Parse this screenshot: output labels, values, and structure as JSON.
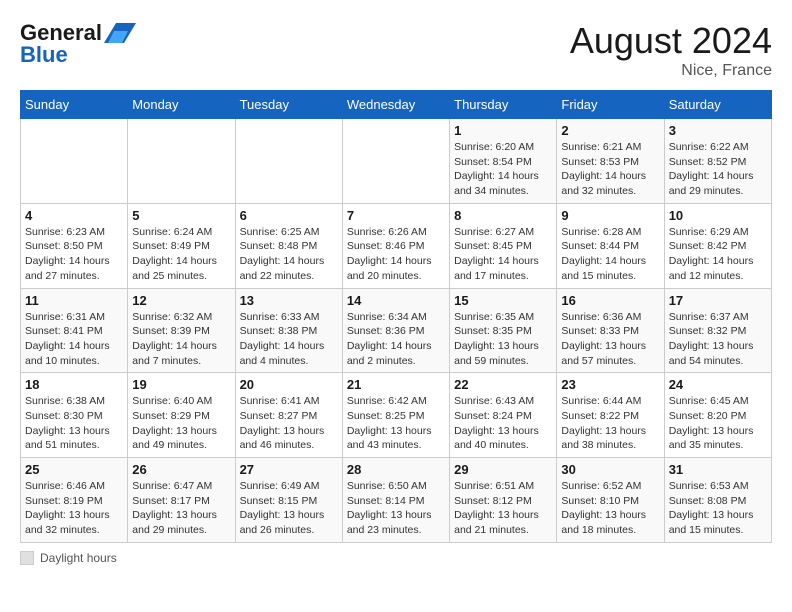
{
  "header": {
    "logo_general": "General",
    "logo_blue": "Blue",
    "month": "August 2024",
    "location": "Nice, France"
  },
  "days_of_week": [
    "Sunday",
    "Monday",
    "Tuesday",
    "Wednesday",
    "Thursday",
    "Friday",
    "Saturday"
  ],
  "weeks": [
    [
      {
        "day": "",
        "info": ""
      },
      {
        "day": "",
        "info": ""
      },
      {
        "day": "",
        "info": ""
      },
      {
        "day": "",
        "info": ""
      },
      {
        "day": "1",
        "info": "Sunrise: 6:20 AM\nSunset: 8:54 PM\nDaylight: 14 hours and 34 minutes."
      },
      {
        "day": "2",
        "info": "Sunrise: 6:21 AM\nSunset: 8:53 PM\nDaylight: 14 hours and 32 minutes."
      },
      {
        "day": "3",
        "info": "Sunrise: 6:22 AM\nSunset: 8:52 PM\nDaylight: 14 hours and 29 minutes."
      }
    ],
    [
      {
        "day": "4",
        "info": "Sunrise: 6:23 AM\nSunset: 8:50 PM\nDaylight: 14 hours and 27 minutes."
      },
      {
        "day": "5",
        "info": "Sunrise: 6:24 AM\nSunset: 8:49 PM\nDaylight: 14 hours and 25 minutes."
      },
      {
        "day": "6",
        "info": "Sunrise: 6:25 AM\nSunset: 8:48 PM\nDaylight: 14 hours and 22 minutes."
      },
      {
        "day": "7",
        "info": "Sunrise: 6:26 AM\nSunset: 8:46 PM\nDaylight: 14 hours and 20 minutes."
      },
      {
        "day": "8",
        "info": "Sunrise: 6:27 AM\nSunset: 8:45 PM\nDaylight: 14 hours and 17 minutes."
      },
      {
        "day": "9",
        "info": "Sunrise: 6:28 AM\nSunset: 8:44 PM\nDaylight: 14 hours and 15 minutes."
      },
      {
        "day": "10",
        "info": "Sunrise: 6:29 AM\nSunset: 8:42 PM\nDaylight: 14 hours and 12 minutes."
      }
    ],
    [
      {
        "day": "11",
        "info": "Sunrise: 6:31 AM\nSunset: 8:41 PM\nDaylight: 14 hours and 10 minutes."
      },
      {
        "day": "12",
        "info": "Sunrise: 6:32 AM\nSunset: 8:39 PM\nDaylight: 14 hours and 7 minutes."
      },
      {
        "day": "13",
        "info": "Sunrise: 6:33 AM\nSunset: 8:38 PM\nDaylight: 14 hours and 4 minutes."
      },
      {
        "day": "14",
        "info": "Sunrise: 6:34 AM\nSunset: 8:36 PM\nDaylight: 14 hours and 2 minutes."
      },
      {
        "day": "15",
        "info": "Sunrise: 6:35 AM\nSunset: 8:35 PM\nDaylight: 13 hours and 59 minutes."
      },
      {
        "day": "16",
        "info": "Sunrise: 6:36 AM\nSunset: 8:33 PM\nDaylight: 13 hours and 57 minutes."
      },
      {
        "day": "17",
        "info": "Sunrise: 6:37 AM\nSunset: 8:32 PM\nDaylight: 13 hours and 54 minutes."
      }
    ],
    [
      {
        "day": "18",
        "info": "Sunrise: 6:38 AM\nSunset: 8:30 PM\nDaylight: 13 hours and 51 minutes."
      },
      {
        "day": "19",
        "info": "Sunrise: 6:40 AM\nSunset: 8:29 PM\nDaylight: 13 hours and 49 minutes."
      },
      {
        "day": "20",
        "info": "Sunrise: 6:41 AM\nSunset: 8:27 PM\nDaylight: 13 hours and 46 minutes."
      },
      {
        "day": "21",
        "info": "Sunrise: 6:42 AM\nSunset: 8:25 PM\nDaylight: 13 hours and 43 minutes."
      },
      {
        "day": "22",
        "info": "Sunrise: 6:43 AM\nSunset: 8:24 PM\nDaylight: 13 hours and 40 minutes."
      },
      {
        "day": "23",
        "info": "Sunrise: 6:44 AM\nSunset: 8:22 PM\nDaylight: 13 hours and 38 minutes."
      },
      {
        "day": "24",
        "info": "Sunrise: 6:45 AM\nSunset: 8:20 PM\nDaylight: 13 hours and 35 minutes."
      }
    ],
    [
      {
        "day": "25",
        "info": "Sunrise: 6:46 AM\nSunset: 8:19 PM\nDaylight: 13 hours and 32 minutes."
      },
      {
        "day": "26",
        "info": "Sunrise: 6:47 AM\nSunset: 8:17 PM\nDaylight: 13 hours and 29 minutes."
      },
      {
        "day": "27",
        "info": "Sunrise: 6:49 AM\nSunset: 8:15 PM\nDaylight: 13 hours and 26 minutes."
      },
      {
        "day": "28",
        "info": "Sunrise: 6:50 AM\nSunset: 8:14 PM\nDaylight: 13 hours and 23 minutes."
      },
      {
        "day": "29",
        "info": "Sunrise: 6:51 AM\nSunset: 8:12 PM\nDaylight: 13 hours and 21 minutes."
      },
      {
        "day": "30",
        "info": "Sunrise: 6:52 AM\nSunset: 8:10 PM\nDaylight: 13 hours and 18 minutes."
      },
      {
        "day": "31",
        "info": "Sunrise: 6:53 AM\nSunset: 8:08 PM\nDaylight: 13 hours and 15 minutes."
      }
    ]
  ],
  "footer": {
    "label": "Daylight hours"
  }
}
